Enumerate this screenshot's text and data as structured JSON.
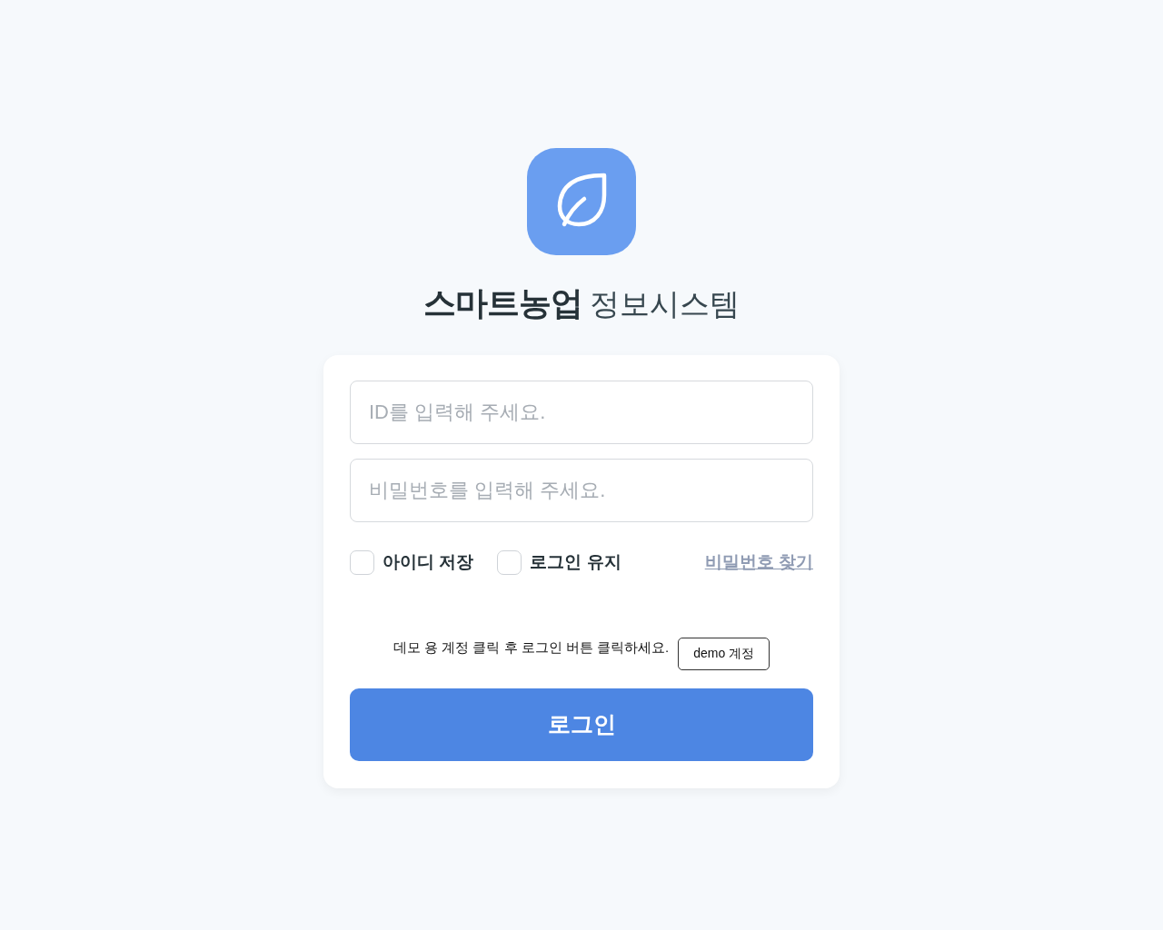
{
  "title": {
    "bold": "스마트농업",
    "light": "정보시스템"
  },
  "fields": [
    {
      "placeholder": "ID를 입력해 주세요."
    },
    {
      "placeholder": "비밀번호를 입력해 주세요."
    }
  ],
  "options": [
    {
      "label": "아이디 저장",
      "checked": false
    },
    {
      "label": "로그인 유지",
      "checked": false
    }
  ],
  "find_password_link": "비밀번호 찾기",
  "demo_hint": "데모 용 계정 클릭 후 로그인 버튼 클릭하세요.",
  "demo_button": "demo 계정",
  "login_button": "로그인"
}
